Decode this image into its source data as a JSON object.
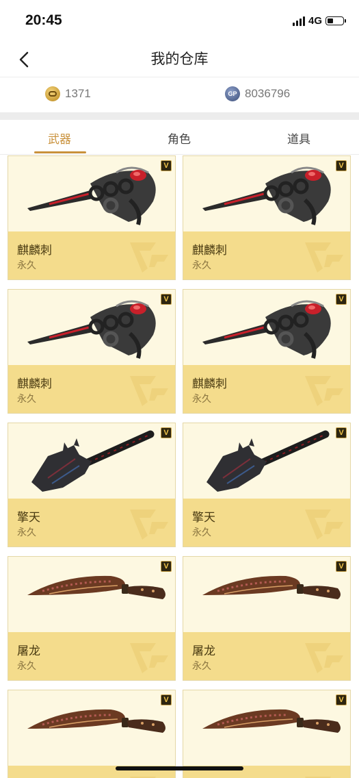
{
  "status_bar": {
    "time": "20:45",
    "network": "4G"
  },
  "nav": {
    "title": "我的仓库"
  },
  "currency": {
    "coin": "1371",
    "gp_label": "GP",
    "gp": "8036796"
  },
  "tabs": [
    {
      "label": "武器",
      "active": true
    },
    {
      "label": "角色",
      "active": false
    },
    {
      "label": "道具",
      "active": false
    }
  ],
  "badge_label": "V",
  "items": [
    {
      "name": "麒麟刺",
      "duration": "永久",
      "weapon": "knuckle-blade"
    },
    {
      "name": "麒麟刺",
      "duration": "永久",
      "weapon": "knuckle-blade"
    },
    {
      "name": "麒麟刺",
      "duration": "永久",
      "weapon": "knuckle-blade"
    },
    {
      "name": "麒麟刺",
      "duration": "永久",
      "weapon": "knuckle-blade"
    },
    {
      "name": "擎天",
      "duration": "永久",
      "weapon": "spade"
    },
    {
      "name": "擎天",
      "duration": "永久",
      "weapon": "spade"
    },
    {
      "name": "屠龙",
      "duration": "永久",
      "weapon": "kukri"
    },
    {
      "name": "屠龙",
      "duration": "永久",
      "weapon": "kukri"
    },
    {
      "name": "",
      "duration": "",
      "weapon": "kukri"
    },
    {
      "name": "",
      "duration": "",
      "weapon": "kukri"
    }
  ],
  "colors": {
    "accent": "#c9913b",
    "card_bg": "#fdf8e1",
    "card_footer": "#f4dc8c"
  }
}
